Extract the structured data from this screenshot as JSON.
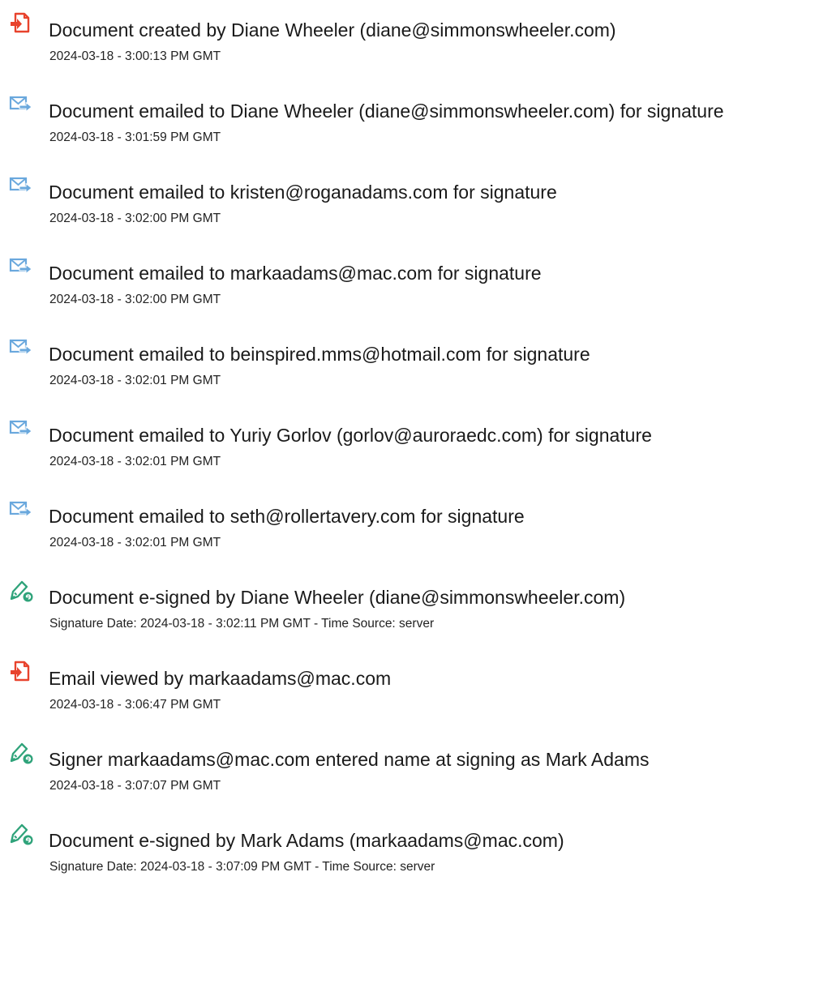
{
  "events": [
    {
      "icon": "document-created-icon",
      "title": "Document created by Diane Wheeler (diane@simmonswheeler.com)",
      "time": "2024-03-18 - 3:00:13 PM GMT"
    },
    {
      "icon": "email-sent-icon",
      "title": "Document emailed to Diane Wheeler (diane@simmonswheeler.com) for signature",
      "time": "2024-03-18 - 3:01:59 PM GMT"
    },
    {
      "icon": "email-sent-icon",
      "title": "Document emailed to kristen@roganadams.com for signature",
      "time": "2024-03-18 - 3:02:00 PM GMT"
    },
    {
      "icon": "email-sent-icon",
      "title": "Document emailed to markaadams@mac.com for signature",
      "time": "2024-03-18 - 3:02:00 PM GMT"
    },
    {
      "icon": "email-sent-icon",
      "title": "Document emailed to beinspired.mms@hotmail.com for signature",
      "time": "2024-03-18 - 3:02:01 PM GMT"
    },
    {
      "icon": "email-sent-icon",
      "title": "Document emailed to Yuriy Gorlov (gorlov@auroraedc.com) for signature",
      "time": "2024-03-18 - 3:02:01 PM GMT"
    },
    {
      "icon": "email-sent-icon",
      "title": "Document emailed to seth@rollertavery.com for signature",
      "time": "2024-03-18 - 3:02:01 PM GMT"
    },
    {
      "icon": "esign-pen-icon",
      "title": "Document e-signed by Diane Wheeler (diane@simmonswheeler.com)",
      "time": "Signature Date: 2024-03-18 - 3:02:11 PM GMT - Time Source: server"
    },
    {
      "icon": "document-created-icon",
      "title": "Email viewed by markaadams@mac.com",
      "time": "2024-03-18 - 3:06:47 PM GMT"
    },
    {
      "icon": "esign-pen-icon",
      "title": "Signer markaadams@mac.com entered name at signing as Mark Adams",
      "time": "2024-03-18 - 3:07:07 PM GMT"
    },
    {
      "icon": "esign-pen-icon",
      "title": "Document e-signed by Mark Adams (markaadams@mac.com)",
      "time": "Signature Date: 2024-03-18 - 3:07:09 PM GMT - Time Source: server"
    }
  ],
  "colors": {
    "document_icon": "#e8432d",
    "email_icon": "#6aa8dd",
    "pen_icon": "#2fa37a",
    "title_text": "#1a1a1a",
    "time_text": "#222222"
  }
}
